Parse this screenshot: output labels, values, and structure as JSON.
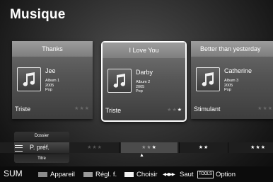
{
  "page": {
    "title": "Musique"
  },
  "cards": [
    {
      "title": "Thanks",
      "artist": "Jee",
      "album": "Album 1",
      "year": "2005",
      "genre": "Pop",
      "mood": "Triste",
      "rating": 0,
      "max_rating": 3
    },
    {
      "title": "I Love You",
      "artist": "Darby",
      "album": "Album 2",
      "year": "2005",
      "genre": "Pop",
      "mood": "Triste",
      "rating": 1,
      "max_rating": 3
    },
    {
      "title": "Better than yesterday",
      "artist": "Catherine",
      "album": "Album 3",
      "year": "2005",
      "genre": "Pop",
      "mood": "Stimulant",
      "rating": 0,
      "max_rating": 3
    }
  ],
  "selector": {
    "tab_above": "Dossier",
    "current": "P. préf.",
    "tab_below": "Titre",
    "segments": [
      "★★★",
      "★★★",
      "★★",
      "★★★"
    ],
    "active_segment": 1
  },
  "footer": {
    "sum": "SUM",
    "appareil": "Appareil",
    "regl": "Régl. f.",
    "choisir": "Choisir",
    "saut_glyph": "◀◀ ▶▶",
    "saut": "Saut",
    "tools": "TOOLS",
    "option": "Option"
  },
  "icons": {
    "thumb": "music-note-icon",
    "menu": "menu-lines-icon",
    "arrow": "arrow-up-icon"
  },
  "colors": {
    "key_appareil": "#8c8c8c",
    "key_regl": "#9a9a9a",
    "key_choisir": "#f2f2f2"
  }
}
